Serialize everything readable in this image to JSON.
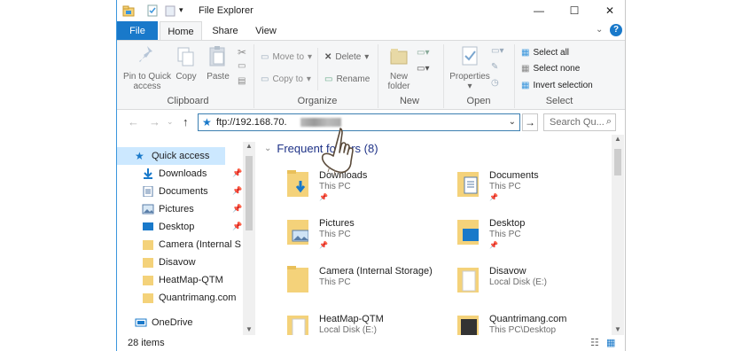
{
  "window": {
    "title": "File Explorer"
  },
  "tabs": {
    "file": "File",
    "home": "Home",
    "share": "Share",
    "view": "View"
  },
  "ribbon": {
    "clipboard": {
      "pin_line1": "Pin to Quick",
      "pin_line2": "access",
      "copy": "Copy",
      "paste": "Paste",
      "group": "Clipboard"
    },
    "organize": {
      "move_to": "Move to",
      "copy_to": "Copy to",
      "delete": "Delete",
      "rename": "Rename",
      "group": "Organize"
    },
    "new": {
      "line1": "New",
      "line2": "folder",
      "group": "New"
    },
    "open": {
      "properties": "Properties",
      "group": "Open"
    },
    "select": {
      "all": "Select all",
      "none": "Select none",
      "invert": "Invert selection",
      "group": "Select"
    }
  },
  "address": {
    "value": "ftp://192.168.70.",
    "search_placeholder": "Search Qu..."
  },
  "nav": {
    "quick_access": "Quick access",
    "items": [
      "Downloads",
      "Documents",
      "Pictures",
      "Desktop",
      "Camera (Internal Stora",
      "Disavow",
      "HeatMap-QTM",
      "Quantrimang.com"
    ],
    "onedrive": "OneDrive"
  },
  "content": {
    "section": "Frequent folders (8)",
    "folders": [
      {
        "name": "Downloads",
        "location": "This PC"
      },
      {
        "name": "Documents",
        "location": "This PC"
      },
      {
        "name": "Pictures",
        "location": "This PC"
      },
      {
        "name": "Desktop",
        "location": "This PC"
      },
      {
        "name": "Camera (Internal Storage)",
        "location": "This PC"
      },
      {
        "name": "Disavow",
        "location": "Local Disk (E:)"
      },
      {
        "name": "HeatMap-QTM",
        "location": "Local Disk (E:)"
      },
      {
        "name": "Quantrimang.com",
        "location": "This PC\\Desktop"
      }
    ]
  },
  "status": {
    "count": "28 items"
  },
  "colors": {
    "accent": "#1979ca",
    "folder": "#f4d27a",
    "selection": "#cce8ff"
  }
}
